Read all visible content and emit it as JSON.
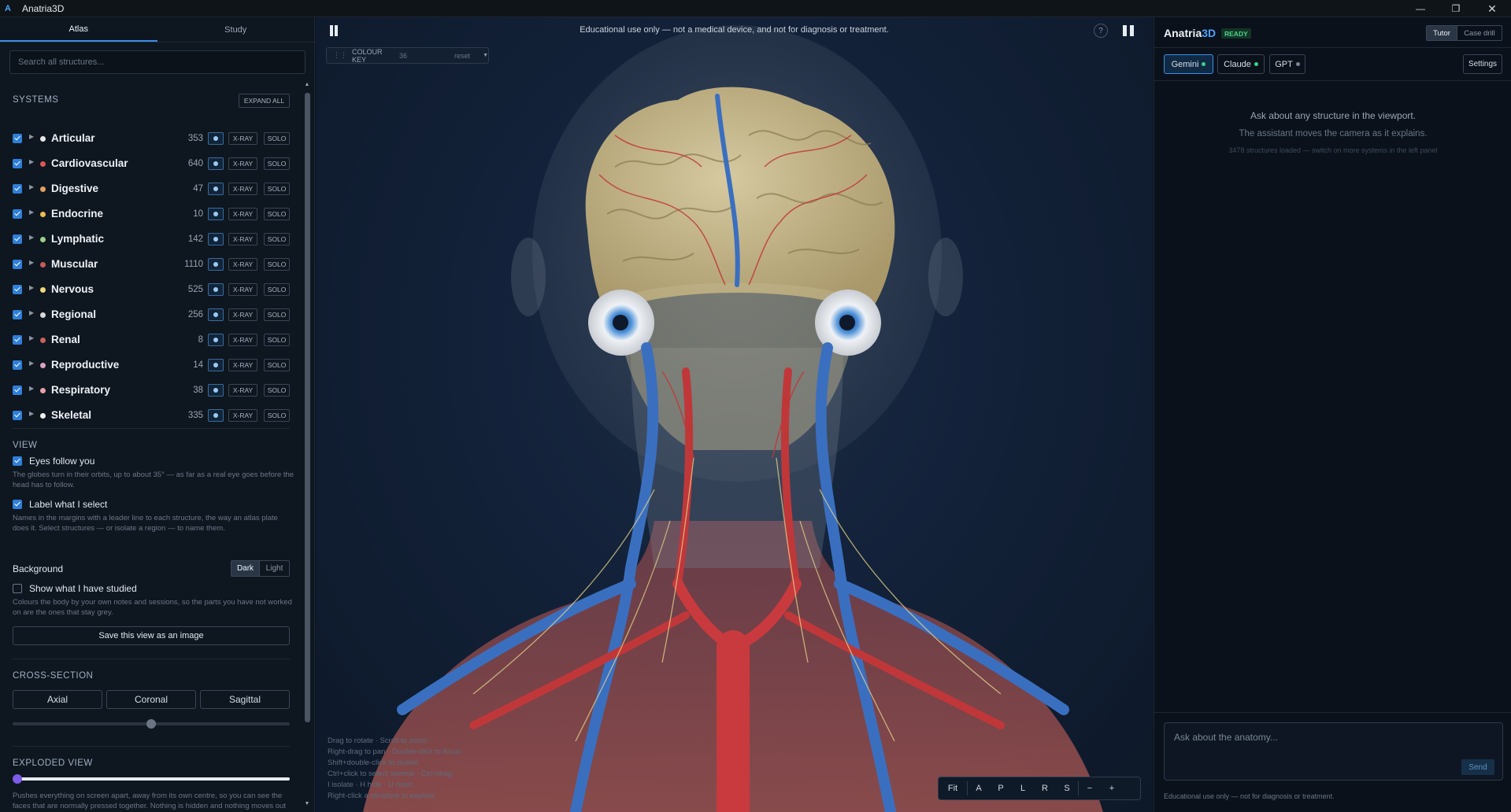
{
  "app": {
    "title": "Anatria3D"
  },
  "left": {
    "tabs": [
      "Atlas",
      "Study"
    ],
    "search_placeholder": "Search all structures...",
    "systems_heading": "SYSTEMS",
    "expand_all": "EXPAND ALL",
    "xray_label": "X-RAY",
    "solo_label": "SOLO",
    "systems": [
      {
        "name": "Articular",
        "count": "353",
        "color": "#e8e8e8"
      },
      {
        "name": "Cardiovascular",
        "count": "640",
        "color": "#e05555"
      },
      {
        "name": "Digestive",
        "count": "47",
        "color": "#e0a060"
      },
      {
        "name": "Endocrine",
        "count": "10",
        "color": "#e8c050"
      },
      {
        "name": "Lymphatic",
        "count": "142",
        "color": "#9ad08a"
      },
      {
        "name": "Muscular",
        "count": "1110",
        "color": "#c85a5a"
      },
      {
        "name": "Nervous",
        "count": "525",
        "color": "#f0d878"
      },
      {
        "name": "Regional",
        "count": "256",
        "color": "#d8d8d8"
      },
      {
        "name": "Renal",
        "count": "8",
        "color": "#c86060"
      },
      {
        "name": "Reproductive",
        "count": "14",
        "color": "#e0a0c0"
      },
      {
        "name": "Respiratory",
        "count": "38",
        "color": "#e8a0a8"
      },
      {
        "name": "Skeletal",
        "count": "335",
        "color": "#f0f0f0"
      }
    ],
    "view": {
      "heading": "VIEW",
      "eyes_label": "Eyes follow you",
      "eyes_desc": "The globes turn in their orbits, up to about 35° — as far as a real eye goes before the head has to follow.",
      "label_select": "Label what I select",
      "label_desc": "Names in the margins with a leader line to each structure, the way an atlas plate does it. Select structures — or isolate a region — to name them.",
      "background_label": "Background",
      "bg_dark": "Dark",
      "bg_light": "Light",
      "studied_label": "Show what I have studied",
      "studied_desc": "Colours the body by your own notes and sessions, so the parts you have not worked on are the ones that stay grey.",
      "save_image": "Save this view as an image"
    },
    "cross_section": {
      "heading": "CROSS-SECTION",
      "axial": "Axial",
      "coronal": "Coronal",
      "sagittal": "Sagittal",
      "slider_value": 0.5
    },
    "exploded": {
      "heading": "EXPLODED VIEW",
      "slider_value": 0,
      "desc": "Pushes everything on screen apart, away from its own centre, so you can see the faces that are normally pressed together. Nothing is hidden and nothing moves out of order — slide back to zero for the anatomy exactly as it was. X"
    }
  },
  "viewport": {
    "notice": "Educational use only — not a medical device, and not for diagnosis or treatment.",
    "help": "?",
    "colour_key": {
      "label": "COLOUR KEY",
      "count": "36",
      "reset": "reset"
    },
    "hints": [
      "Drag to rotate · Scroll to zoom",
      "Right-drag to pan · Double-click to focus",
      "Shift+double-click to isolate",
      "Ctrl+click to select several · Ctrl+drag",
      "I isolate · H hide · U reset",
      "Right-click a structure to explore"
    ],
    "nav": [
      "Fit",
      "A",
      "P",
      "L",
      "R",
      "S",
      "−",
      "+"
    ]
  },
  "right": {
    "brand_main": "Anatria",
    "brand_accent": "3D",
    "status": "READY",
    "mode_tutor": "Tutor",
    "mode_case": "Case drill",
    "models": [
      {
        "name": "Gemini",
        "dot": "#3fd08a"
      },
      {
        "name": "Claude",
        "dot": "#3fd08a"
      },
      {
        "name": "GPT",
        "dot": "#7a8696"
      }
    ],
    "settings": "Settings",
    "msg_1": "Ask about any structure in the viewport.",
    "msg_2": "The assistant moves the camera as it explains.",
    "msg_3": "3478 structures loaded — switch on more systems in the left panel",
    "input_placeholder": "Ask about the anatomy...",
    "send": "Send",
    "footer": "Educational use only — not for diagnosis or treatment."
  }
}
